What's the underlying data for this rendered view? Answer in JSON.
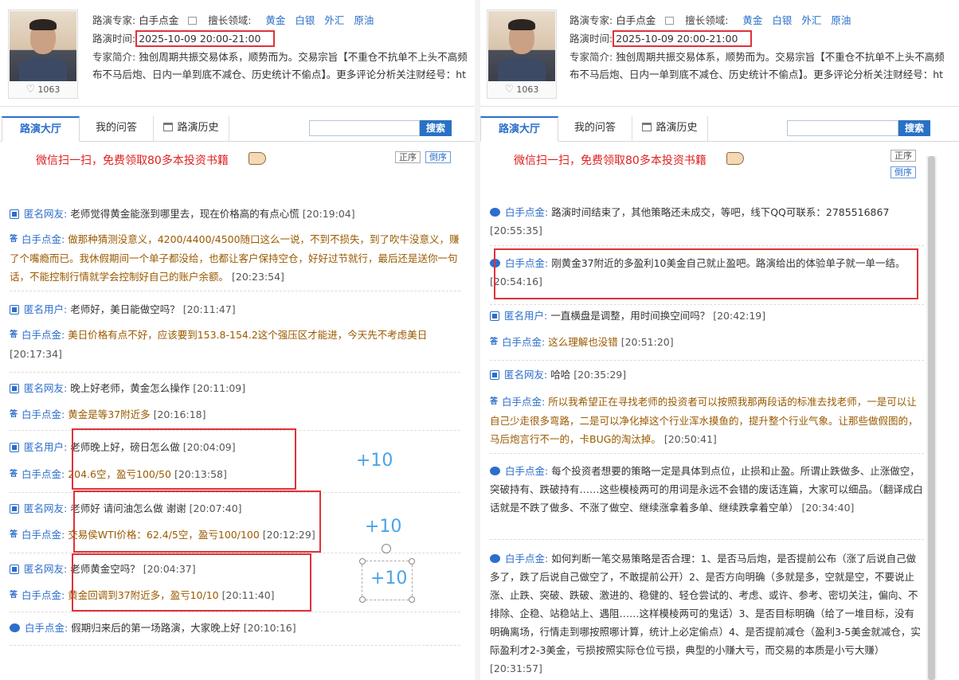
{
  "panes": [
    {
      "expert_label": "路演专家:",
      "expert_name": "白手点金",
      "field_label": "擅长领域:",
      "fields": [
        "黄金",
        "白银",
        "外汇",
        "原油"
      ],
      "time_label": "路演时间:",
      "time_value": "2025-10-09 20:00-21:00",
      "intro_label": "专家简介:",
      "intro_line1": "独创周期共振交易体系，顺势而为。交易宗旨【不重仓不抗单不上头不高频",
      "intro_line2": "布不马后炮、日内一单到底不减仓、历史统计不偷点】。更多评论分析关注财经号：ht",
      "likes": "1063",
      "tabs": [
        "路演大厅",
        "我的问答",
        "路演历史"
      ],
      "search_button": "搜索",
      "search_placeholder": "",
      "promo": "微信扫一扫，免费领取80多本投资书籍",
      "sort_asc": "正序",
      "sort_desc": "倒序",
      "messages": [
        {
          "kind": "q",
          "who": "匿名网友:",
          "text": "老师觉得黄金能涨到哪里去，现在价格高的有点心慌",
          "time": "[20:19:04]"
        },
        {
          "kind": "a",
          "who": "白手点金:",
          "text": "做那种猜测没意义，4200/4400/4500随口这么一说，不到不损失，到了吹牛没意义，赚了个嘴瘾而已。我休假期间一个单子都没给，也都让客户保持空仓，好好过节就行，最后还是送你一句话，不能控制行情就学会控制好自己的账户余额。",
          "time": "[20:23:54]"
        },
        {
          "kind": "q",
          "who": "匿名用户:",
          "text": "老师好，美日能做空吗？",
          "time": "[20:11:47]"
        },
        {
          "kind": "a",
          "who": "白手点金:",
          "text": "美日价格有点不好，应该要到153.8-154.2这个强压区才能进，今天先不考虑美日",
          "time": "[20:17:34]"
        },
        {
          "kind": "q",
          "who": "匿名网友:",
          "text": "晚上好老师，黄金怎么操作",
          "time": "[20:11:09]"
        },
        {
          "kind": "a",
          "who": "白手点金:",
          "text": "黄金是等37附近多",
          "time": "[20:16:18]"
        },
        {
          "kind": "q",
          "who": "匿名用户:",
          "text": "老师晚上好，磅日怎么做",
          "time": "[20:04:09]"
        },
        {
          "kind": "a",
          "who": "白手点金:",
          "text": "204.6空，盈亏100/50",
          "time": "[20:13:58]"
        },
        {
          "kind": "q",
          "who": "匿名网友:",
          "text": "老师好 请问油怎么做 谢谢",
          "time": "[20:07:40]"
        },
        {
          "kind": "a",
          "who": "白手点金:",
          "text": "交易侯WTI价格：62.4/5空，盈亏100/100",
          "time": "[20:12:29]"
        },
        {
          "kind": "q",
          "who": "匿名网友:",
          "text": "老师黄金空吗？",
          "time": "[20:04:37]"
        },
        {
          "kind": "a",
          "who": "白手点金:",
          "text": "黄金回调到37附近多，盈亏10/10",
          "time": "[20:11:40]"
        },
        {
          "kind": "d",
          "who": "白手点金:",
          "text": "假期归来后的第一场路演，大家晚上好",
          "time": "[20:10:16]"
        }
      ],
      "plus": [
        "+10",
        "+10",
        "+10"
      ]
    },
    {
      "messages": [
        {
          "kind": "d",
          "who": "白手点金:",
          "text": "路演时间结束了，其他策略还未成交，等吧，线下QQ可联系：2785516867",
          "time": "[20:55:35]"
        },
        {
          "kind": "d",
          "who": "白手点金:",
          "text": "刚黄金37附近的多盈利10美金自己就止盈吧。路演给出的体验单子就一单一结。",
          "time": "[20:54:16]"
        },
        {
          "kind": "q",
          "who": "匿名用户:",
          "text": "一直横盘是调整，用时间换空间吗？",
          "time": "[20:42:19]"
        },
        {
          "kind": "a",
          "who": "白手点金:",
          "text": "这么理解也没错",
          "time": "[20:51:20]"
        },
        {
          "kind": "q",
          "who": "匿名网友:",
          "text": "哈哈",
          "time": "[20:35:29]"
        },
        {
          "kind": "a",
          "who": "白手点金:",
          "text": "所以我希望正在寻找老师的投资者可以按照我那两段话的标准去找老师，一是可以让自己少走很多弯路，二是可以净化掉这个行业浑水摸鱼的，提升整个行业气象。让那些做假图的，马后炮言行不一的，卡BUG的淘汰掉。",
          "time": "[20:50:41]"
        },
        {
          "kind": "d",
          "who": "白手点金:",
          "text": "每个投资者想要的策略一定是具体到点位，止损和止盈。所谓止跌做多、止涨做空，突破持有、跌破持有……这些模棱两可的用词是永远不会错的废话连篇，大家可以细品。（翻译成白话就是不跌了做多、不涨了做空、继续涨拿着多单、继续跌拿着空单）",
          "time": "[20:34:40]"
        },
        {
          "kind": "d",
          "who": "白手点金:",
          "text": "如何判断一笔交易策略是否合理：1、是否马后炮，是否提前公布（涨了后说自己做多了，跌了后说自己做空了，不敢提前公开）2、是否方向明确（多就是多，空就是空，不要说止涨、止跌、突破、跌破、激进的、稳健的、轻仓尝试的、考虑、或许、参考、密切关注，偏向、不排除、企稳、站稳站上、遇阻……这样模棱两可的鬼话）3、是否目标明确（给了一堆目标，没有明确离场，行情走到哪按照哪计算，统计上必定偷点）4、是否提前减仓（盈利3-5美金就减仓，实际盈利才2-3美金，亏损按照实际仓位亏损，典型的小赚大亏，而交易的本质是小亏大赚）",
          "time": "[20:31:57]"
        }
      ]
    }
  ],
  "colors": {
    "accent": "#2d6ecb",
    "highlight": "#e0323a",
    "answer": "#9a5a00",
    "promo": "#e02020"
  }
}
